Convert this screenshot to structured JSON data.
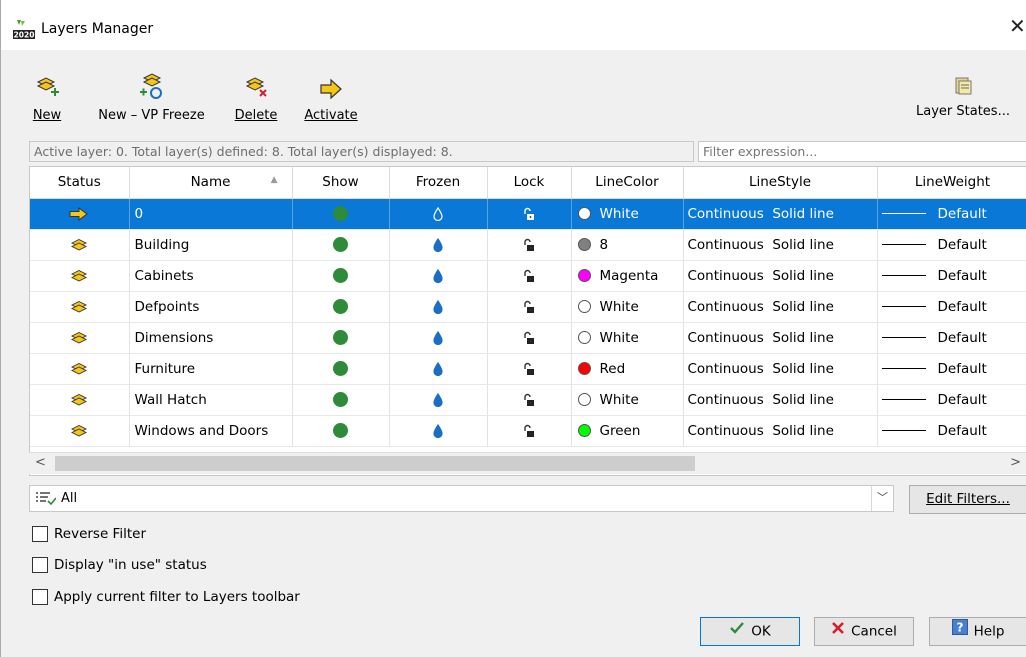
{
  "window": {
    "title": "Layers Manager",
    "app_icon_text": "2020",
    "close_icon": "close-icon"
  },
  "toolbar": {
    "new_label": "New",
    "vp_freeze_label": "New – VP Freeze",
    "delete_label": "Delete",
    "activate_label": "Activate",
    "layer_states_label": "Layer States..."
  },
  "info": {
    "text": "Active layer: 0. Total layer(s) defined: 8. Total layer(s) displayed: 8.",
    "filter_placeholder": "Filter expression..."
  },
  "table": {
    "headers": [
      "Status",
      "Name",
      "Show",
      "Frozen",
      "Lock",
      "LineColor",
      "LineStyle",
      "LineWeight"
    ],
    "rows": [
      {
        "status": "active-arrow-icon",
        "name": "0",
        "color_name": "White",
        "color_hex": "#ffffff",
        "style": "Continuous",
        "style_desc": "Solid line",
        "weight": "Default",
        "selected": true
      },
      {
        "status": "layer-icon",
        "name": "Building",
        "color_name": "8",
        "color_hex": "#808080",
        "style": "Continuous",
        "style_desc": "Solid line",
        "weight": "Default",
        "selected": false
      },
      {
        "status": "layer-icon",
        "name": "Cabinets",
        "color_name": "Magenta",
        "color_hex": "#ff00ff",
        "style": "Continuous",
        "style_desc": "Solid line",
        "weight": "Default",
        "selected": false
      },
      {
        "status": "layer-icon",
        "name": "Defpoints",
        "color_name": "White",
        "color_hex": "#ffffff",
        "style": "Continuous",
        "style_desc": "Solid line",
        "weight": "Default",
        "selected": false
      },
      {
        "status": "layer-icon",
        "name": "Dimensions",
        "color_name": "White",
        "color_hex": "#ffffff",
        "style": "Continuous",
        "style_desc": "Solid line",
        "weight": "Default",
        "selected": false
      },
      {
        "status": "layer-icon",
        "name": "Furniture",
        "color_name": "Red",
        "color_hex": "#ff0000",
        "style": "Continuous",
        "style_desc": "Solid line",
        "weight": "Default",
        "selected": false
      },
      {
        "status": "layer-icon",
        "name": "Wall Hatch",
        "color_name": "White",
        "color_hex": "#ffffff",
        "style": "Continuous",
        "style_desc": "Solid line",
        "weight": "Default",
        "selected": false
      },
      {
        "status": "layer-icon",
        "name": "Windows and Doors",
        "color_name": "Green",
        "color_hex": "#00ff00",
        "style": "Continuous",
        "style_desc": "Solid line",
        "weight": "Default",
        "selected": false
      }
    ]
  },
  "filter": {
    "selected": "All",
    "edit_filters_label": "Edit Filters..."
  },
  "options": {
    "reverse_filter_label": "Reverse Filter",
    "in_use_label": "Display \"in use\" status",
    "apply_toolbar_label": "Apply current filter to Layers toolbar"
  },
  "buttons": {
    "ok_label": "OK",
    "cancel_label": "Cancel",
    "help_label": "Help"
  },
  "colors": {
    "selection": "#0a78d7",
    "show_dot": "#2e8b3a",
    "frozen_drop": "#1a6fc4",
    "layer_icon": "#f5c518"
  }
}
